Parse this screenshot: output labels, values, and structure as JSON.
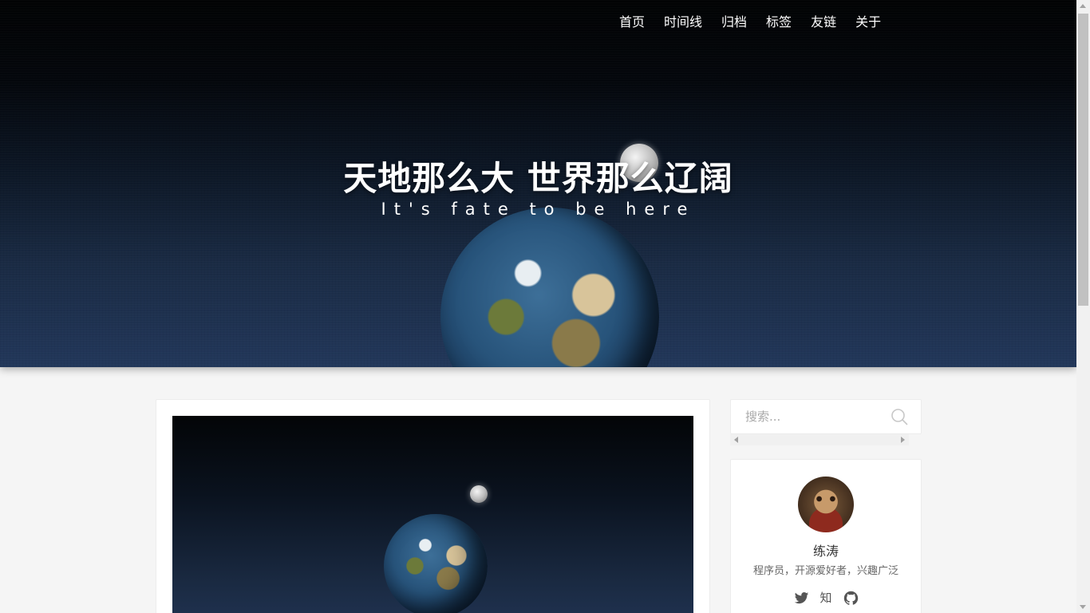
{
  "nav": {
    "items": [
      {
        "label": "首页"
      },
      {
        "label": "时间线"
      },
      {
        "label": "归档"
      },
      {
        "label": "标签"
      },
      {
        "label": "友链"
      },
      {
        "label": "关于"
      }
    ]
  },
  "hero": {
    "title": "天地那么大 世界那么辽阔",
    "subtitle": "It's fate to be here"
  },
  "search": {
    "placeholder": "搜索..."
  },
  "profile": {
    "name": "练涛",
    "description": "程序员，开源爱好者，兴趣广泛",
    "social": {
      "zhihu_label": "知"
    }
  },
  "icons": {
    "search": "search-icon",
    "twitter": "twitter-icon",
    "zhihu": "zhihu-icon",
    "github": "github-icon"
  },
  "colors": {
    "page_background": "#f5f5f5",
    "hero_top": "#020304",
    "hero_bottom": "#22375a",
    "nav_text": "#ffffff",
    "card_background": "#ffffff"
  }
}
